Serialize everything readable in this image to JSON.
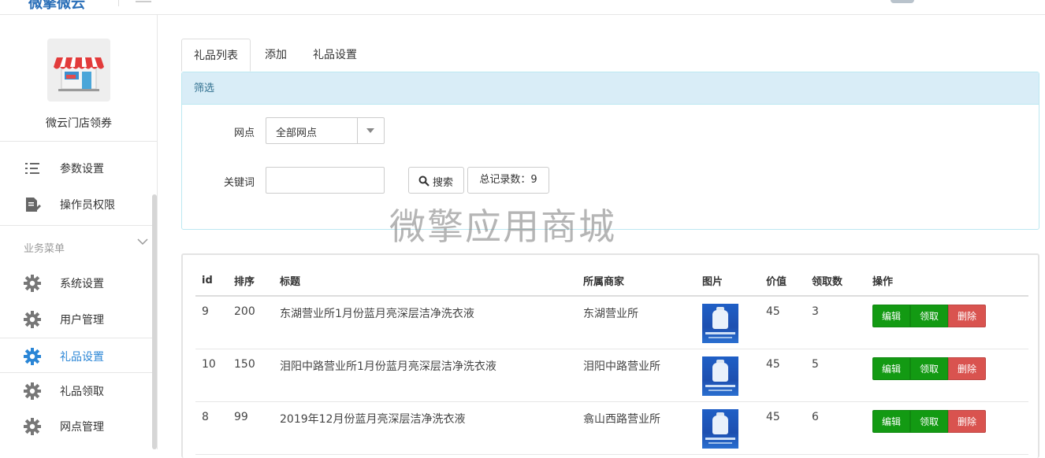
{
  "brand": {
    "text": "微擎微云"
  },
  "sidebar": {
    "store_name": "微云门店领券",
    "items_top": [
      {
        "label": "参数设置",
        "icon": "list-icon"
      },
      {
        "label": "操作员权限",
        "icon": "document-edit-icon"
      }
    ],
    "section_title": "业务菜单",
    "items": [
      {
        "label": "系统设置",
        "icon": "gear-icon",
        "active": false
      },
      {
        "label": "用户管理",
        "icon": "gear-icon",
        "active": false
      },
      {
        "label": "礼品设置",
        "icon": "gear-icon",
        "active": true
      },
      {
        "label": "礼品领取",
        "icon": "gear-icon",
        "active": false
      },
      {
        "label": "网点管理",
        "icon": "gear-icon",
        "active": false
      }
    ]
  },
  "tabs": [
    {
      "label": "礼品列表",
      "active": true
    },
    {
      "label": "添加",
      "active": false
    },
    {
      "label": "礼品设置",
      "active": false
    }
  ],
  "filter": {
    "heading": "筛选",
    "branch_label": "网点",
    "branch_value": "全部网点",
    "keyword_label": "关键词",
    "keyword_value": "",
    "search_button": "搜索",
    "total_label": "总记录数：9"
  },
  "watermark": "微擎应用商城",
  "table": {
    "headers": [
      "id",
      "排序",
      "标题",
      "所属商家",
      "图片",
      "价值",
      "领取数",
      "操作"
    ],
    "rows": [
      {
        "id": "9",
        "sort": "200",
        "title": "东湖营业所1月份蓝月亮深层洁净洗衣液",
        "merchant": "东湖营业所",
        "value": "45",
        "claimed": "3"
      },
      {
        "id": "10",
        "sort": "150",
        "title": "泪阳中路营业所1月份蓝月亮深层洁净洗衣液",
        "merchant": "泪阳中路营业所",
        "value": "45",
        "claimed": "5"
      },
      {
        "id": "8",
        "sort": "99",
        "title": "2019年12月份蓝月亮深层洁净洗衣液",
        "merchant": "翕山西路营业所",
        "value": "45",
        "claimed": "6"
      }
    ],
    "actions": {
      "edit": "编辑",
      "take": "领取",
      "delete": "删除"
    }
  },
  "colors": {
    "accent": "#2b86d6",
    "success": "#139a13",
    "danger": "#d9534f",
    "info_bg": "#d9edf7"
  }
}
